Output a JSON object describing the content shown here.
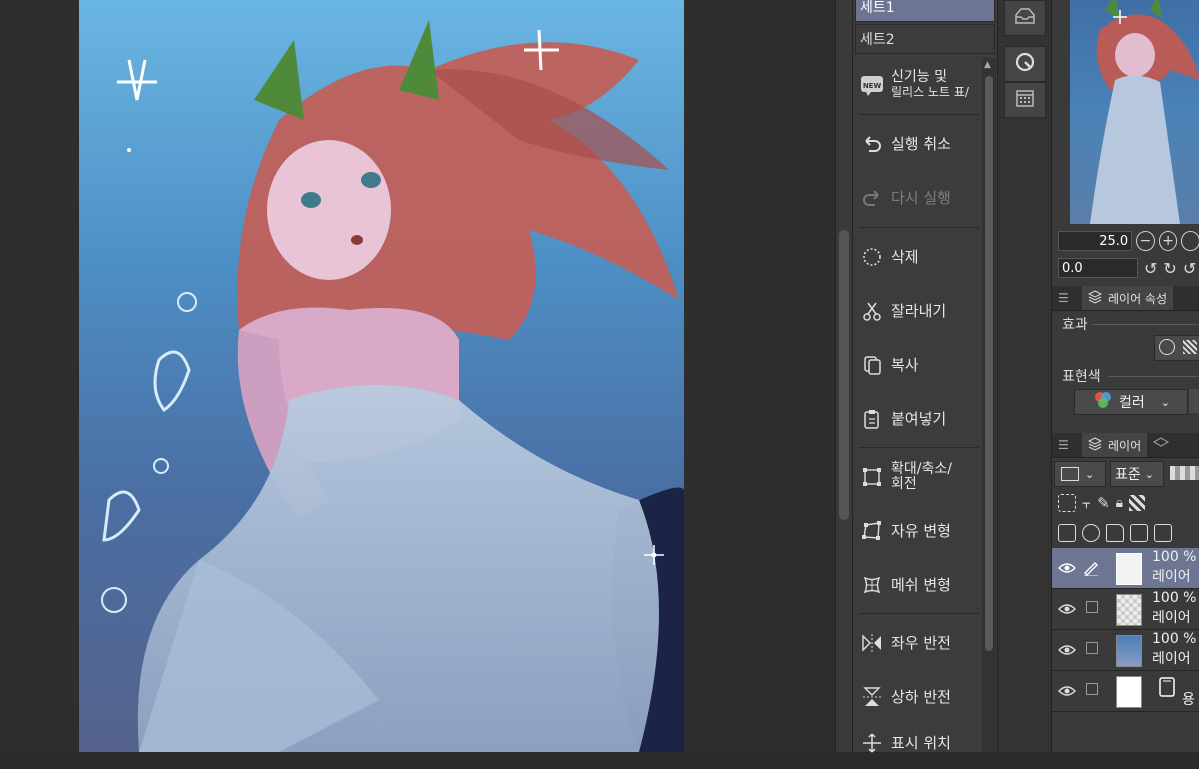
{
  "command_bar": {
    "sets": [
      {
        "label": "세트1",
        "selected": true
      },
      {
        "label": "세트2",
        "selected": false
      }
    ],
    "commands": [
      {
        "label_line1": "신기능 및",
        "label_line2": "릴리스 노트 표/",
        "icon": "new-badge-icon",
        "enabled": true
      },
      {
        "label_line1": "실행 취소",
        "label_line2": "",
        "icon": "undo-icon",
        "enabled": true
      },
      {
        "label_line1": "다시 실행",
        "label_line2": "",
        "icon": "redo-icon",
        "enabled": false
      },
      {
        "label_line1": "삭제",
        "label_line2": "",
        "icon": "delete-icon",
        "enabled": true
      },
      {
        "label_line1": "잘라내기",
        "label_line2": "",
        "icon": "scissors-icon",
        "enabled": true
      },
      {
        "label_line1": "복사",
        "label_line2": "",
        "icon": "copy-icon",
        "enabled": true
      },
      {
        "label_line1": "붙여넣기",
        "label_line2": "",
        "icon": "paste-icon",
        "enabled": true
      },
      {
        "label_line1": "확대/축소/",
        "label_line2": "회전",
        "icon": "scale-rotate-icon",
        "enabled": true
      },
      {
        "label_line1": "자유 변형",
        "label_line2": "",
        "icon": "free-transform-icon",
        "enabled": true
      },
      {
        "label_line1": "메쉬 변형",
        "label_line2": "",
        "icon": "mesh-transform-icon",
        "enabled": true
      },
      {
        "label_line1": "좌우 반전",
        "label_line2": "",
        "icon": "flip-horizontal-icon",
        "enabled": true
      },
      {
        "label_line1": "상하 반전",
        "label_line2": "",
        "icon": "flip-vertical-icon",
        "enabled": true
      },
      {
        "label_line1": "표시 위치",
        "label_line2": "",
        "icon": "display-position-icon",
        "enabled": true
      }
    ]
  },
  "navigator": {
    "zoom": "25.0",
    "rotation": "0.0"
  },
  "layer_property": {
    "tab_label": "레이어 속성",
    "effect_label": "효과",
    "expression_color_label": "표현색",
    "expression_color_value": "컬러"
  },
  "layer_panel": {
    "tab_label": "레이어",
    "blend_mode": "표준",
    "layers": [
      {
        "opacity": "100 %",
        "name": "레이어",
        "selected": true
      },
      {
        "opacity": "100 %",
        "name": "레이어",
        "selected": false
      },
      {
        "opacity": "100 %",
        "name": "레이어",
        "selected": false
      },
      {
        "opacity": "",
        "name": "용",
        "selected": false
      }
    ]
  },
  "colors": {
    "selection": "#6d7593",
    "panel_bg": "#3c3c3c",
    "canvas_top": "#6ab6e3",
    "canvas_bottom": "#55628c"
  }
}
